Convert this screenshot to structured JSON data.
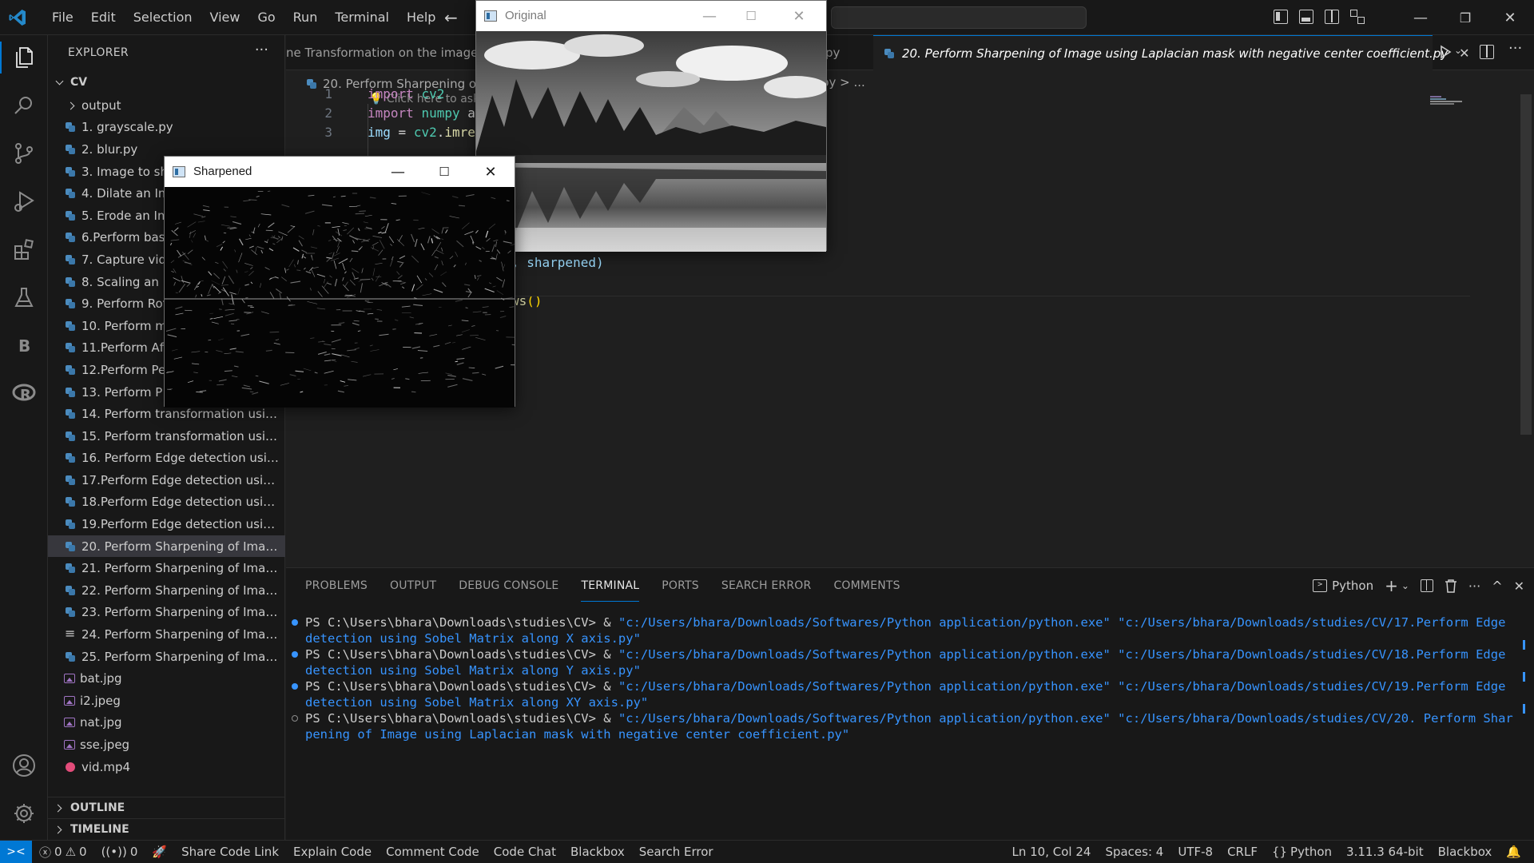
{
  "menu": [
    "File",
    "Edit",
    "Selection",
    "View",
    "Go",
    "Run",
    "Terminal",
    "Help"
  ],
  "window_controls": {
    "minimize": "—",
    "restore": "❐",
    "close": "✕"
  },
  "sidebar": {
    "title": "EXPLORER",
    "more": "···",
    "folder": "CV",
    "items": [
      {
        "name": "output",
        "type": "folder"
      },
      {
        "name": "1. grayscale.py",
        "type": "py"
      },
      {
        "name": "2. blur.py",
        "type": "py"
      },
      {
        "name": "3. Image to sh",
        "type": "py"
      },
      {
        "name": "4. Dilate an Im",
        "type": "py"
      },
      {
        "name": "5. Erode an Im",
        "type": "py"
      },
      {
        "name": "6.Perform basi",
        "type": "py"
      },
      {
        "name": "7. Capture vide",
        "type": "py"
      },
      {
        "name": "8. Scaling an ir",
        "type": "py"
      },
      {
        "name": "9. Perform Rot",
        "type": "py"
      },
      {
        "name": "10. Perform m",
        "type": "py"
      },
      {
        "name": "11.Perform Aff",
        "type": "py"
      },
      {
        "name": "12.Perform Pe",
        "type": "py"
      },
      {
        "name": "13.  Perform P",
        "type": "py"
      },
      {
        "name": "14. Perform transformation using ...",
        "type": "py"
      },
      {
        "name": "15. Perform transformation using ...",
        "type": "py"
      },
      {
        "name": "16. Perform Edge detection using...",
        "type": "py"
      },
      {
        "name": "17.Perform Edge detection using ...",
        "type": "py"
      },
      {
        "name": "18.Perform Edge detection using ...",
        "type": "py"
      },
      {
        "name": "19.Perform Edge detection using ...",
        "type": "py"
      },
      {
        "name": "20. Perform Sharpening of Image ...",
        "type": "py",
        "selected": true
      },
      {
        "name": "21. Perform Sharpening of Image ...",
        "type": "py"
      },
      {
        "name": "22. Perform Sharpening of Image ...",
        "type": "py"
      },
      {
        "name": "23. Perform Sharpening of Image ...",
        "type": "py"
      },
      {
        "name": "24. Perform Sharpening of Image ...",
        "type": "txt"
      },
      {
        "name": "25. Perform Sharpening of Image ...",
        "type": "py"
      },
      {
        "name": "bat.jpg",
        "type": "img"
      },
      {
        "name": "i2.jpeg",
        "type": "img"
      },
      {
        "name": "nat.jpg",
        "type": "img"
      },
      {
        "name": "sse.jpeg",
        "type": "img"
      },
      {
        "name": "vid.mp4",
        "type": "vid"
      }
    ],
    "outline": "OUTLINE",
    "timeline": "TIMELINE"
  },
  "tabs": {
    "left_partial": "ne Transformation on the image.p",
    "mid_partial": "py",
    "active": "20. Perform Sharpening of Image using Laplacian mask with negative center coefficient.py",
    "close": "✕",
    "more": "···"
  },
  "editor": {
    "breadcrumb": "20. Perform Sharpening of",
    "breadcrumb_tail": "py > ...",
    "copilot_hint": "💡 Click here to ask",
    "lines": [
      {
        "num": "1",
        "tokens": [
          [
            "kw",
            "import "
          ],
          [
            "mod",
            "cv2"
          ]
        ]
      },
      {
        "num": "2",
        "tokens": [
          [
            "kw",
            "import "
          ],
          [
            "mod",
            "numpy"
          ],
          [
            "plain",
            " a"
          ]
        ]
      },
      {
        "num": "3",
        "tokens": [
          [
            "var",
            "img"
          ],
          [
            "plain",
            " = "
          ],
          [
            "mod",
            "cv2"
          ],
          [
            "plain",
            "."
          ],
          [
            "fn",
            "imre"
          ]
        ]
      }
    ],
    "visible_fragments": {
      "line_8": ", sharpened)",
      "line_10_fn": "ws",
      "line_10_paren": "()"
    }
  },
  "panel": {
    "tabs": [
      "PROBLEMS",
      "OUTPUT",
      "DEBUG CONSOLE",
      "TERMINAL",
      "PORTS",
      "SEARCH ERROR",
      "COMMENTS"
    ],
    "active_tab": "TERMINAL",
    "terminal_profile": "Python",
    "actions": {
      "add": "+",
      "dropdown": "⌄",
      "more": "···",
      "maximize": "^",
      "close": "✕"
    }
  },
  "terminal": [
    {
      "status": "done",
      "prompt": "PS C:\\Users\\bhara\\Downloads\\studies\\CV> & ",
      "command": "\"c:/Users/bhara/Downloads/Softwares/Python application/python.exe\" \"c:/Users/bhara/Downloads/studies/CV/17.Perform Edge detection using Sobel Matrix along X axis.py\""
    },
    {
      "status": "done",
      "prompt": "PS C:\\Users\\bhara\\Downloads\\studies\\CV> & ",
      "command": "\"c:/Users/bhara/Downloads/Softwares/Python application/python.exe\" \"c:/Users/bhara/Downloads/studies/CV/18.Perform Edge detection using Sobel Matrix along Y axis.py\""
    },
    {
      "status": "done",
      "prompt": "PS C:\\Users\\bhara\\Downloads\\studies\\CV> & ",
      "command": "\"c:/Users/bhara/Downloads/Softwares/Python application/python.exe\" \"c:/Users/bhara/Downloads/studies/CV/19.Perform Edge detection using Sobel Matrix along XY axis.py\""
    },
    {
      "status": "running",
      "prompt": "PS C:\\Users\\bhara\\Downloads\\studies\\CV> & ",
      "command": "\"c:/Users/bhara/Downloads/Softwares/Python application/python.exe\" \"c:/Users/bhara/Downloads/studies/CV/20. Perform Sharpening of Image using Laplacian mask with negative center coefficient.py\""
    }
  ],
  "statusbar": {
    "errors": "0",
    "warnings": "0",
    "ports": "0",
    "left_items": [
      "Share Code Link",
      "Explain Code",
      "Comment Code",
      "Code Chat",
      "Blackbox",
      "Search Error"
    ],
    "right_items": [
      "Ln 10, Col 24",
      "Spaces: 4",
      "UTF-8",
      "CRLF",
      "Python",
      "3.11.3 64-bit",
      "Blackbox"
    ]
  },
  "windows": {
    "original": {
      "title": "Original"
    },
    "sharpened": {
      "title": "Sharpened"
    }
  },
  "colors": {
    "accent": "#0078d4",
    "editor_bg": "#1f1f1f",
    "sidebar_bg": "#181818",
    "terminal_link": "#3794ff"
  }
}
